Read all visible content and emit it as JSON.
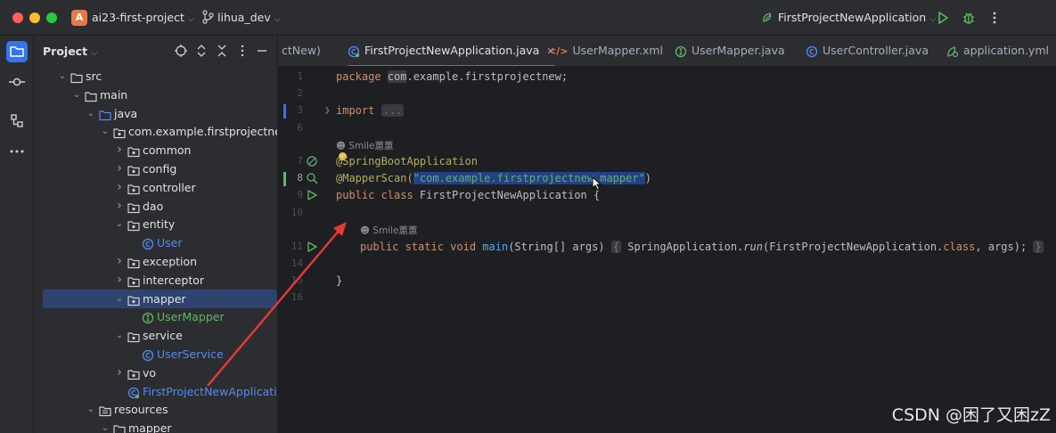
{
  "titlebar": {
    "project_badge": "A",
    "project_name": "ai23-first-project",
    "branch": "lihua_dev",
    "run_config": "FirstProjectNewApplication",
    "icons": [
      "branch-icon",
      "run-icon",
      "debug-icon",
      "more-icon"
    ]
  },
  "toolstrip": {
    "icons": [
      "project-folder-icon",
      "commit-icon",
      "structure-icon",
      "more-icon"
    ]
  },
  "project_panel": {
    "title": "Project",
    "tools": [
      "locate-icon",
      "expand-all-icon",
      "collapse-all-icon",
      "hide-icon"
    ],
    "tree": [
      {
        "label": "src",
        "depth": 1,
        "kind": "folder",
        "expanded": true
      },
      {
        "label": "main",
        "depth": 2,
        "kind": "folder",
        "expanded": true
      },
      {
        "label": "java",
        "depth": 3,
        "kind": "source-folder",
        "expanded": true
      },
      {
        "label": "com.example.firstprojectnew",
        "depth": 4,
        "kind": "package",
        "expanded": true
      },
      {
        "label": "common",
        "depth": 5,
        "kind": "package",
        "expanded": false
      },
      {
        "label": "config",
        "depth": 5,
        "kind": "package",
        "expanded": false
      },
      {
        "label": "controller",
        "depth": 5,
        "kind": "package",
        "expanded": false
      },
      {
        "label": "dao",
        "depth": 5,
        "kind": "package",
        "expanded": false
      },
      {
        "label": "entity",
        "depth": 5,
        "kind": "package",
        "expanded": true
      },
      {
        "label": "User",
        "depth": 6,
        "kind": "class"
      },
      {
        "label": "exception",
        "depth": 5,
        "kind": "package",
        "expanded": false
      },
      {
        "label": "interceptor",
        "depth": 5,
        "kind": "package",
        "expanded": false
      },
      {
        "label": "mapper",
        "depth": 5,
        "kind": "package",
        "expanded": true,
        "selected": true
      },
      {
        "label": "UserMapper",
        "depth": 6,
        "kind": "interface"
      },
      {
        "label": "service",
        "depth": 5,
        "kind": "package",
        "expanded": true
      },
      {
        "label": "UserService",
        "depth": 6,
        "kind": "class"
      },
      {
        "label": "vo",
        "depth": 5,
        "kind": "package",
        "expanded": false
      },
      {
        "label": "FirstProjectNewApplication",
        "depth": 5,
        "kind": "spring-class"
      },
      {
        "label": "resources",
        "depth": 3,
        "kind": "resources-folder",
        "expanded": true
      },
      {
        "label": "mapper",
        "depth": 4,
        "kind": "folder",
        "expanded": true
      }
    ]
  },
  "tabs": [
    {
      "label": "ctNew)",
      "kind": "cut",
      "active": false
    },
    {
      "label": "FirstProjectNewApplication.java",
      "kind": "spring-class",
      "active": true,
      "closable": true
    },
    {
      "label": "UserMapper.xml",
      "kind": "xml",
      "active": false
    },
    {
      "label": "UserMapper.java",
      "kind": "interface",
      "active": false
    },
    {
      "label": "UserController.java",
      "kind": "class",
      "active": false
    },
    {
      "label": "application.yml",
      "kind": "yml",
      "active": false
    }
  ],
  "editor": {
    "line_numbers": [
      "1",
      "2",
      "3",
      "6",
      "7",
      "8",
      "9",
      "10",
      "11",
      "14",
      "15",
      "16"
    ],
    "current_line": "8",
    "lines": {
      "l1_kw": "package ",
      "l1_sel": "com",
      "l1_rest": ".example.firstprojectnew;",
      "l3_kw": "import ",
      "l3_fold": "...",
      "author_hint": "Smile蕙蕙",
      "l7_ann": "@SpringBootApplication",
      "l8_ann": "@MapperScan(",
      "l8_str": "\"com.example.firstprojectnew.mapper\"",
      "l8_close": ")",
      "l9_kw": "public class ",
      "l9_name": "FirstProjectNewApplication {",
      "l11_kw": "public static void ",
      "l11_fn": "main",
      "l11_params": "(String[] args) ",
      "l11_open": "{",
      "l11_call1": " SpringApplication.",
      "l11_run": "run",
      "l11_args1": "(FirstProjectNewApplication.",
      "l11_class_kw": "class",
      "l11_args2": ", args); ",
      "l11_close": "}",
      "l15": "}"
    }
  },
  "watermark": "CSDN @困了又困zZ",
  "colors": {
    "accent": "#3574f0",
    "annotation_arrow": "#e53935",
    "keyword": "#cf8e6d",
    "string": "#6aab73",
    "annotation": "#b3ae60"
  }
}
